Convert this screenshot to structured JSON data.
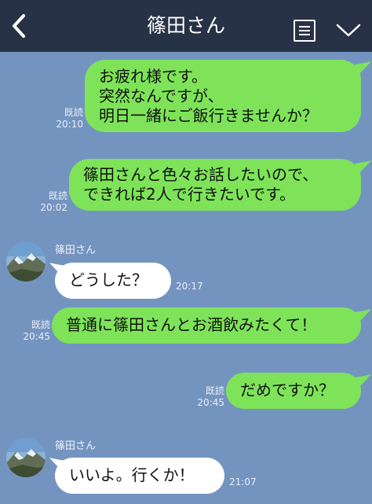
{
  "header": {
    "title": "篠田さん"
  },
  "messages": [
    {
      "direction": "out",
      "lines": [
        "お疲れ様です。",
        "突然なんですが、",
        "明日一緒にご飯行きませんか？"
      ],
      "read": "既読",
      "time": "20:10"
    },
    {
      "direction": "out",
      "lines": [
        "篠田さんと色々お話したいので、",
        "できれば2人で行きたいです。"
      ],
      "read": "既読",
      "time": "20:02"
    },
    {
      "direction": "in",
      "sender": "篠田さん",
      "text": "どうした？",
      "time": "20:17"
    },
    {
      "direction": "out",
      "text": "普通に篠田さんとお酒飲みたくて！",
      "read": "既読",
      "time": "20:45"
    },
    {
      "direction": "out",
      "text": "だめですか？",
      "read": "既読",
      "time": "20:45"
    },
    {
      "direction": "in",
      "sender": "篠田さん",
      "text": "いいよ。行くか！",
      "time": "21:07"
    }
  ],
  "icons": {
    "back": "chevron-left-icon",
    "menu": "menu-list-icon",
    "dropdown": "chevron-down-icon"
  },
  "colors": {
    "header_bg": "#273246",
    "chat_bg": "#7494c0",
    "outgoing_bubble": "#7ee359",
    "incoming_bubble": "#ffffff"
  }
}
